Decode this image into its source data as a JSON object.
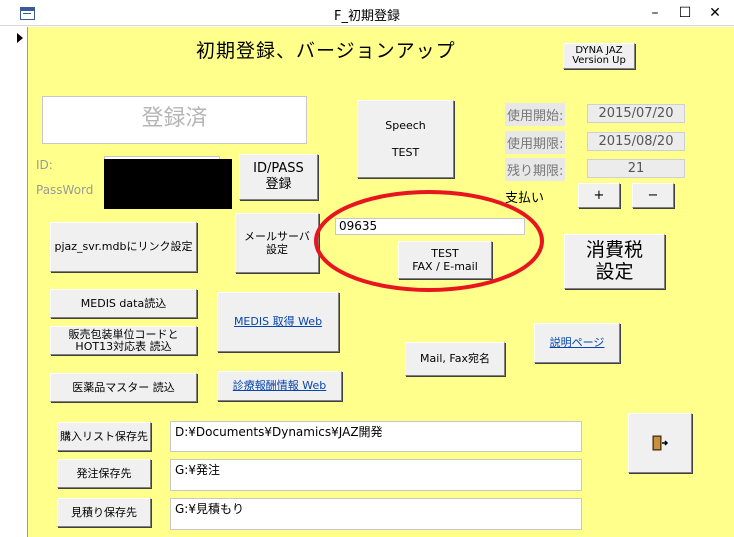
{
  "window": {
    "title": "F_初期登録",
    "minimize": "–",
    "maximize": "☐",
    "close": "✕"
  },
  "header": {
    "title": "初期登録、バージョンアップ",
    "version_button": "DYNA JAZ\nVersion Up"
  },
  "registration": {
    "status": "登録済",
    "id_label": "ID:",
    "password_label": "PassWord",
    "id_pass_button": "ID/PASS\n登録"
  },
  "speech_button": "Speech\n\nTEST",
  "usage": {
    "start_label": "使用開始:",
    "start_value": "2015/07/20",
    "expiry_label": "使用期限:",
    "expiry_value": "2015/08/20",
    "remaining_label": "残り期限:",
    "remaining_value": "21",
    "payment_label": "支払い",
    "plus": "+",
    "minus": "−"
  },
  "buttons": {
    "pjaz_link": "pjaz_svr.mdbにリンク設定",
    "mail_server": "メールサーバ\n設定",
    "test_fax": "TEST\nFAX / E-mail",
    "tax_setting": "消費税\n設定",
    "medis_data": "MEDIS data読込",
    "medis_web": "MEDIS 取得 Web",
    "hot13": "販売包装単位コードと\nHOT13対応表 読込",
    "mail_fax_dest": "Mail, Fax宛名",
    "manual_page": "説明ページ",
    "drug_master": "医薬品マスター 読込",
    "shinryo_web": "診療報酬情報 Web",
    "purchase_list_path": "購入リスト保存先",
    "order_path": "発注保存先",
    "estimate_path": "見積り保存先",
    "exit": "⇥"
  },
  "fax_number": "09635",
  "paths": {
    "purchase_list": "D:¥Documents¥Dynamics¥JAZ開発",
    "order": "G:¥発注",
    "estimate": "G:¥見積もり"
  }
}
